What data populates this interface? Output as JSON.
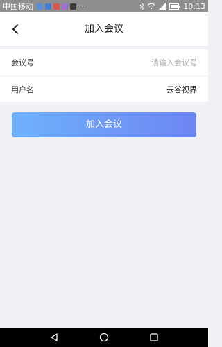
{
  "status_bar": {
    "carrier": "中国移动",
    "more": "···",
    "time": "10:13",
    "notification_icons": [
      {
        "name": "gallery-notif-icon",
        "color": "#5a8fd8"
      },
      {
        "name": "download-notif-icon",
        "color": "#4a7bd0"
      },
      {
        "name": "mail-notif-icon",
        "color": "#d9534f"
      },
      {
        "name": "app-notif-icon",
        "color": "#a070d0"
      },
      {
        "name": "message-notif-icon",
        "color": "#3a3a3a"
      }
    ]
  },
  "header": {
    "title": "加入会议"
  },
  "form": {
    "meeting_id": {
      "label": "会议号",
      "value": "",
      "placeholder": "请输入会议号"
    },
    "username": {
      "label": "用户名",
      "value": "云谷视界"
    }
  },
  "join_button": {
    "label": "加入会议"
  },
  "colors": {
    "background": "#f0f1f6",
    "button_gradient_start": "#6fb1fb",
    "button_gradient_end": "#6d86f3",
    "status_bar": "#8e8e8e"
  }
}
